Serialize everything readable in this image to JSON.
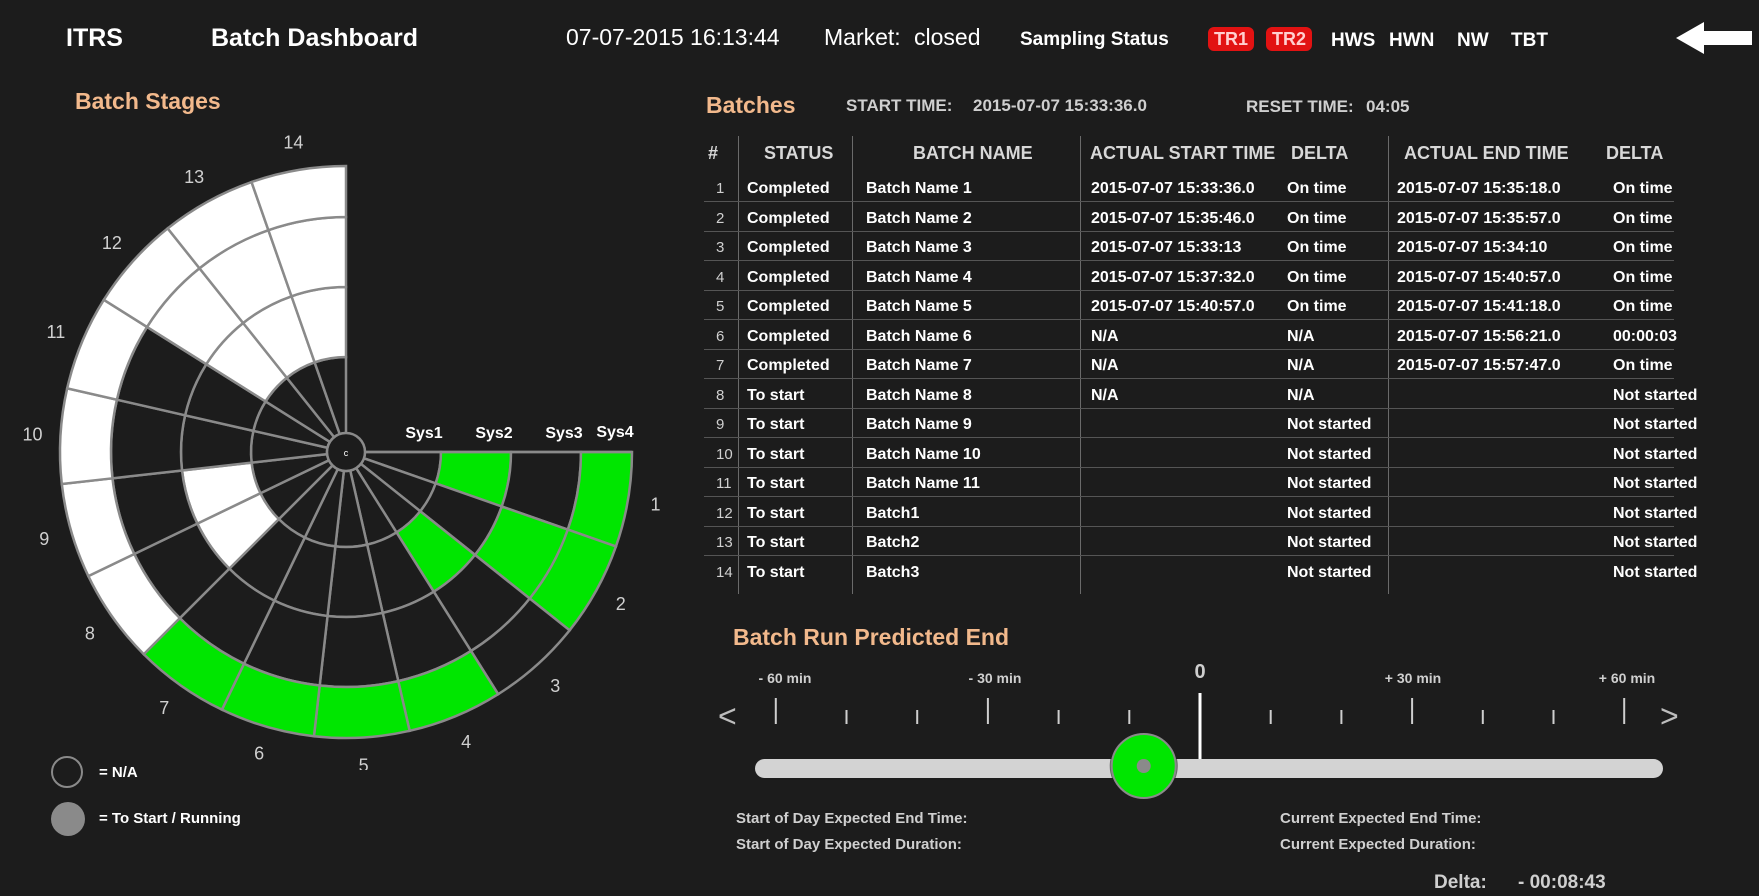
{
  "header": {
    "app_name": "ITRS",
    "title": "Batch Dashboard",
    "datetime": "07-07-2015 16:13:44",
    "market_label": "Market:",
    "market_value": "closed",
    "sampling_label": "Sampling Status",
    "badges": [
      "TR1",
      "TR2"
    ],
    "statuses": [
      "HWS",
      "HWN",
      "NW",
      "TBT"
    ]
  },
  "stages": {
    "title": "Batch Stages",
    "center_label": "c",
    "sector_labels": [
      "1",
      "2",
      "3",
      "4",
      "5",
      "6",
      "7",
      "8",
      "9",
      "10",
      "11",
      "12",
      "13",
      "14"
    ],
    "ring_labels": [
      "Sys1",
      "Sys2",
      "Sys3",
      "Sys4"
    ],
    "legend": [
      {
        "label": "= N/A"
      },
      {
        "label": "= To Start / Running"
      }
    ],
    "colors": {
      "green": "#00e600",
      "white": "#ffffff",
      "dark": "#1c1c1c",
      "grid": "#8a8a8a"
    }
  },
  "batches": {
    "title": "Batches",
    "start_time_label": "START TIME:",
    "start_time_value": "2015-07-07 15:33:36.0",
    "reset_time_label": "RESET TIME:",
    "reset_time_value": "04:05",
    "columns": [
      "#",
      "STATUS",
      "BATCH NAME",
      "ACTUAL START TIME",
      "DELTA",
      "ACTUAL END TIME",
      "DELTA"
    ],
    "rows": [
      [
        "1",
        "Completed",
        "Batch Name 1",
        "2015-07-07 15:33:36.0",
        "On time",
        "2015-07-07 15:35:18.0",
        "On time"
      ],
      [
        "2",
        "Completed",
        "Batch Name 2",
        "2015-07-07 15:35:46.0",
        "On time",
        "2015-07-07 15:35:57.0",
        "On time"
      ],
      [
        "3",
        "Completed",
        "Batch Name 3",
        "2015-07-07 15:33:13",
        "On time",
        "2015-07-07 15:34:10",
        "On time"
      ],
      [
        "4",
        "Completed",
        "Batch Name 4",
        "2015-07-07 15:37:32.0",
        "On time",
        "2015-07-07 15:40:57.0",
        "On time"
      ],
      [
        "5",
        "Completed",
        "Batch Name 5",
        "2015-07-07 15:40:57.0",
        "On time",
        "2015-07-07 15:41:18.0",
        "On time"
      ],
      [
        "6",
        "Completed",
        "Batch Name 6",
        "N/A",
        "N/A",
        "2015-07-07 15:56:21.0",
        "00:00:03"
      ],
      [
        "7",
        "Completed",
        "Batch Name 7",
        "N/A",
        "N/A",
        "2015-07-07 15:57:47.0",
        "On time"
      ],
      [
        "8",
        "To start",
        "Batch Name 8",
        "N/A",
        "N/A",
        "",
        "Not started"
      ],
      [
        "9",
        "To start",
        "Batch Name 9",
        "",
        "Not started",
        "",
        "Not started"
      ],
      [
        "10",
        "To start",
        "Batch Name 10",
        "",
        "Not started",
        "",
        "Not started"
      ],
      [
        "11",
        "To start",
        "Batch Name 11",
        "",
        "Not started",
        "",
        "Not started"
      ],
      [
        "12",
        "To start",
        "Batch1",
        "",
        "Not started",
        "",
        "Not started"
      ],
      [
        "13",
        "To start",
        "Batch2",
        "",
        "Not started",
        "",
        "Not started"
      ],
      [
        "14",
        "To start",
        "Batch3",
        "",
        "Not started",
        "",
        "Not started"
      ]
    ]
  },
  "prediction": {
    "title": "Batch Run Predicted End",
    "ticks": [
      "- 60 min",
      "- 30 min",
      "0",
      "+ 30 min",
      "+ 60 min"
    ],
    "left_arrow": "<",
    "right_arrow": ">",
    "knob_value_min": -8.7,
    "start_day_end_label": "Start of Day Expected End Time:",
    "start_day_duration_label": "Start of Day Expected Duration:",
    "current_end_label": "Current Expected End Time:",
    "current_duration_label": "Current Expected Duration:",
    "delta_label": "Delta:",
    "delta_value": "- 00:08:43"
  }
}
